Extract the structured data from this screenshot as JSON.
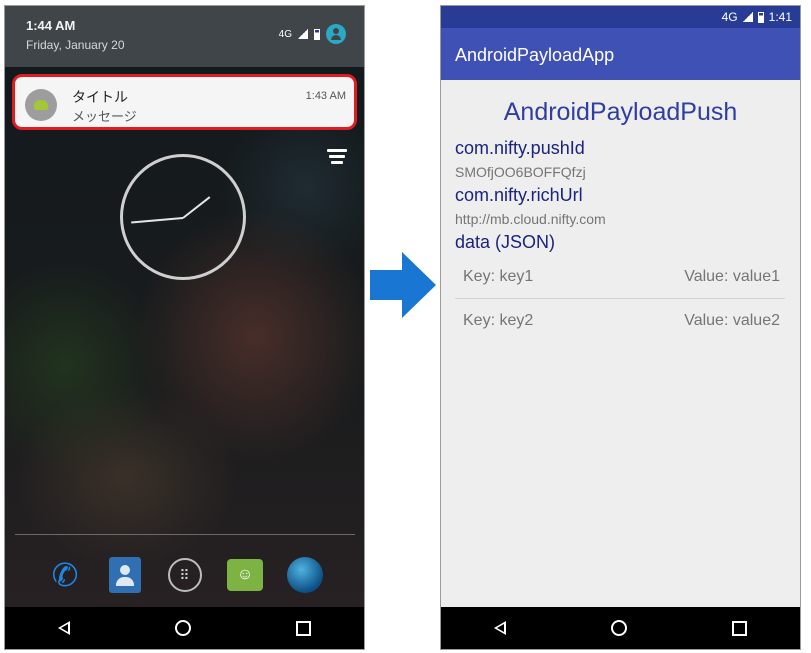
{
  "left": {
    "status": {
      "time": "1:44 AM",
      "date": "Friday, January 20",
      "network": "4G"
    },
    "notification": {
      "title": "タイトル",
      "message": "メッセージ",
      "time": "1:43 AM"
    }
  },
  "right": {
    "status": {
      "network": "4G",
      "time": "1:41"
    },
    "app_title": "AndroidPayloadApp",
    "heading": "AndroidPayloadPush",
    "push_id_label": "com.nifty.pushId",
    "push_id_value": "SMOfjOO6BOFFQfzj",
    "rich_url_label": "com.nifty.richUrl",
    "rich_url_value": "http://mb.cloud.nifty.com",
    "data_label": "data (JSON)",
    "rows": [
      {
        "key": "Key: key1",
        "value": "Value: value1"
      },
      {
        "key": "Key: key2",
        "value": "Value: value2"
      }
    ]
  },
  "colors": {
    "accent": "#3f51b5",
    "status_bar": "#293c95",
    "notification_highlight": "#e01b22",
    "arrow": "#1976d2"
  }
}
